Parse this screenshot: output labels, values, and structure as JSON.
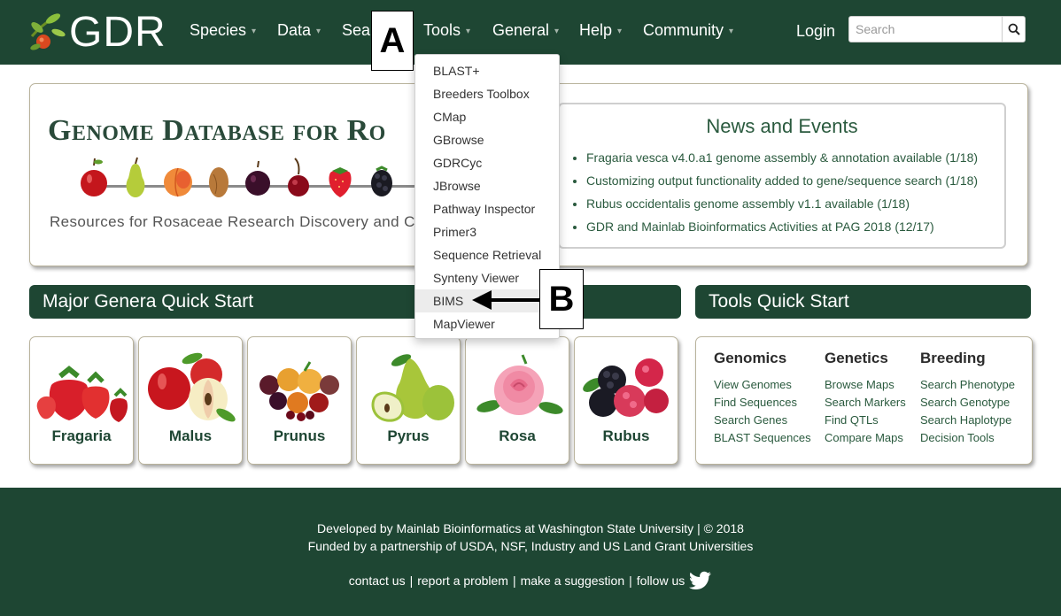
{
  "brand": {
    "name": "GDR"
  },
  "nav": {
    "species": "Species",
    "data": "Data",
    "search": "Sea",
    "tools": "Tools",
    "general": "General",
    "help": "Help",
    "community": "Community",
    "login": "Login",
    "search_placeholder": "Search"
  },
  "annotations": {
    "a": "A",
    "b": "B"
  },
  "tools_menu": [
    "BLAST+",
    "Breeders Toolbox",
    "CMap",
    "GBrowse",
    "GDRCyc",
    "JBrowse",
    "Pathway Inspector",
    "Primer3",
    "Sequence Retrieval",
    "Synteny Viewer",
    "BIMS",
    "MapViewer"
  ],
  "banner": {
    "title": "Genome Database for Ro",
    "subtitle": "Resources for Rosaceae Research Discovery and Cr"
  },
  "news": {
    "title": "News and Events",
    "items": [
      "Fragaria vesca v4.0.a1 genome assembly & annotation available (1/18)",
      "Customizing output functionality added to gene/sequence search (1/18)",
      "Rubus occidentalis genome assembly v1.1 available (1/18)",
      "GDR and Mainlab Bioinformatics Activities at PAG 2018 (12/17)"
    ]
  },
  "major_genera": {
    "title": "Major Genera Quick Start",
    "items": [
      "Fragaria",
      "Malus",
      "Prunus",
      "Pyrus",
      "Rosa",
      "Rubus"
    ]
  },
  "tools_quick": {
    "title": "Tools Quick Start",
    "columns": [
      {
        "heading": "Genomics",
        "links": [
          "View Genomes",
          "Find Sequences",
          "Search Genes",
          "BLAST Sequences"
        ]
      },
      {
        "heading": "Genetics",
        "links": [
          "Browse Maps",
          "Search Markers",
          "Find QTLs",
          "Compare Maps"
        ]
      },
      {
        "heading": "Breeding",
        "links": [
          "Search Phenotype",
          "Search Genotype",
          "Search Haplotype",
          "Decision Tools"
        ]
      }
    ]
  },
  "footer": {
    "line1": "Developed by Mainlab Bioinformatics at Washington State University | © 2018",
    "line2": "Funded by a partnership of  USDA, NSF, Industry and US Land Grant Universities",
    "links": [
      "contact us",
      "report a problem",
      "make a suggestion",
      "follow us"
    ]
  },
  "colors": {
    "brand_green": "#1e4633",
    "link_green": "#2a5a3e"
  }
}
